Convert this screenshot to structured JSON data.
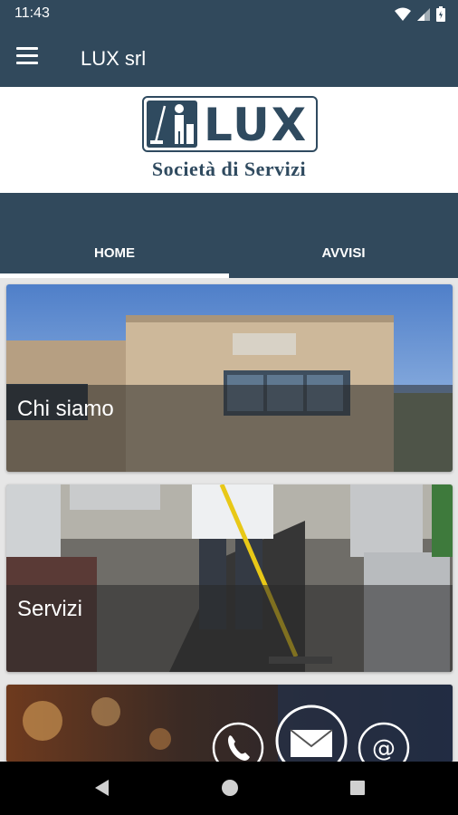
{
  "status_bar": {
    "time": "11:43"
  },
  "app_bar": {
    "title": "LUX srl"
  },
  "logo": {
    "brand_text": "LUX",
    "subtitle": "Società di Servizi"
  },
  "tabs": [
    {
      "label": "HOME",
      "selected": true
    },
    {
      "label": "AVVISI",
      "selected": false
    }
  ],
  "cards": [
    {
      "label": "Chi siamo"
    },
    {
      "label": "Servizi"
    },
    {
      "label": ""
    }
  ],
  "colors": {
    "primary": "#31495c",
    "logo": "#2f4a5f",
    "nav": "#000000"
  }
}
